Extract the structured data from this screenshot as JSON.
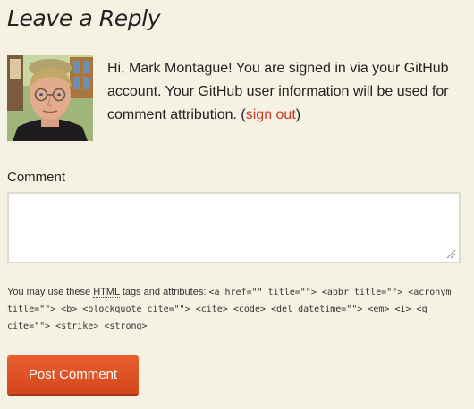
{
  "reply": {
    "title": "Leave a Reply"
  },
  "signed_in": {
    "prefix": "Hi, Mark Montague! You are signed in via your GitHub account. Your GitHub user information will be used for comment attribution. (",
    "sign_out_label": "sign out",
    "suffix": ")"
  },
  "comment": {
    "label": "Comment",
    "value": ""
  },
  "allowed_tags": {
    "intro_before": "You may use these ",
    "abbr": "HTML",
    "intro_after": " tags and attributes: ",
    "tags": "<a href=\"\" title=\"\"> <abbr title=\"\"> <acronym title=\"\"> <b> <blockquote cite=\"\"> <cite> <code> <del datetime=\"\"> <em> <i> <q cite=\"\"> <strike> <strong>"
  },
  "post_button": {
    "label": "Post Comment"
  },
  "colors": {
    "background": "#f5f2e4",
    "link": "#c8391d",
    "button": "#e2552a",
    "button_text": "#ffffff"
  }
}
